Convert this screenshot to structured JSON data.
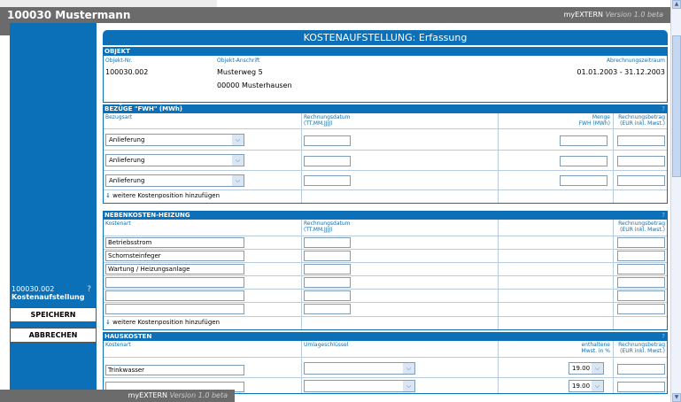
{
  "topbar": {
    "user": "100030  Mustermann",
    "brand": "myEXTERN",
    "version": "Version 1.0 beta"
  },
  "sidebar": {
    "object_id": "100030.002",
    "help": "?",
    "title": "Kostenaufstellung",
    "save": "SPEICHERN",
    "cancel": "ABBRECHEN"
  },
  "page": {
    "title": "KOSTENAUFSTELLUNG: Erfassung"
  },
  "objekt": {
    "header": "OBJEKT",
    "nr_label": "Objekt-Nr.",
    "nr": "100030.002",
    "addr_label": "Objekt-Anschrift",
    "street": "Musterweg 5",
    "city": "00000 Musterhausen",
    "period_label": "Abrechnungszeitraum",
    "period": "01.01.2003 - 31.12.2003"
  },
  "bezuege": {
    "header": "BEZÜGE \"FWH\" (MWh)",
    "help": "?",
    "col_type": "Bezugsart",
    "col_date": "Rechnungsdatum",
    "col_date_fmt": "(TT.MM.JJJJ)",
    "col_qty": "Menge",
    "col_qty_unit": "FWH (MWh)",
    "col_amount": "Rechnungsbetrag",
    "col_amount_unit": "(EUR inkl. Mwst.)",
    "rows": [
      "Anlieferung",
      "Anlieferung",
      "Anlieferung"
    ],
    "add_more": "weitere Kostenposition hinzufügen"
  },
  "nebenkosten": {
    "header": "NEBENKOSTEN-HEIZUNG",
    "help": "?",
    "col_type": "Kostenart",
    "col_date": "Rechnungsdatum",
    "col_date_fmt": "(TT.MM.JJJJ)",
    "col_amount": "Rechnungsbetrag",
    "col_amount_unit": "(EUR inkl. Mwst.)",
    "rows": [
      "Betriebsstrom",
      "Schornsteinfeger",
      "Wartung / Heizungsanlage",
      "",
      "",
      ""
    ],
    "add_more": "weitere Kostenposition hinzufügen"
  },
  "hauskosten": {
    "header": "HAUSKOSTEN",
    "help": "?",
    "col_type": "Kostenart",
    "col_key": "Umlageschlüssel",
    "col_vat": "enthaltene",
    "col_vat_unit": "Mwst. in %",
    "col_amount": "Rechnungsbetrag",
    "col_amount_unit": "(EUR inkl. Mwst.)",
    "rows": [
      {
        "type": "Trinkwasser",
        "vat": "19.00"
      },
      {
        "type": "",
        "vat": "19.00"
      }
    ]
  },
  "footer": {
    "brand": "myEXTERN",
    "version": "Version 1.0 beta"
  }
}
